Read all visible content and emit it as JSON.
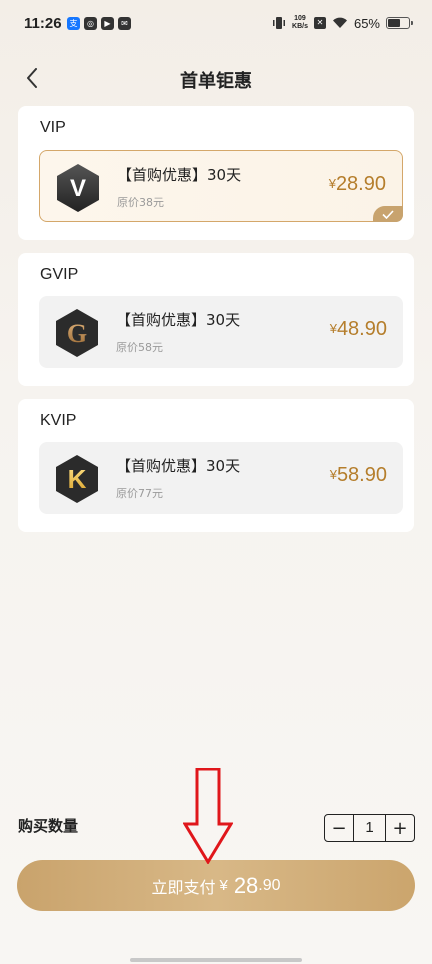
{
  "status_bar": {
    "time": "11:26",
    "app_icons": [
      "支",
      "◎",
      "▶",
      "✉"
    ],
    "net_speed_value": "109",
    "net_speed_unit": "KB/s",
    "battery_percent": "65%",
    "battery_level": 0.65
  },
  "header": {
    "title": "首单钜惠",
    "back_icon": "chevron-left-icon"
  },
  "cards": [
    {
      "title": "VIP",
      "badge_letter": "V",
      "plan_name": "【首购优惠】30天",
      "original_price": "原价38元",
      "currency": "¥",
      "price": "28.90",
      "selected": true
    },
    {
      "title": "GVIP",
      "badge_letter": "G",
      "plan_name": "【首购优惠】30天",
      "original_price": "原价58元",
      "currency": "¥",
      "price": "48.90",
      "selected": false
    },
    {
      "title": "KVIP",
      "badge_letter": "K",
      "plan_name": "【首购优惠】30天",
      "original_price": "原价77元",
      "currency": "¥",
      "price": "58.90",
      "selected": false
    }
  ],
  "quantity": {
    "label": "购买数量",
    "minus": "−",
    "value": "1",
    "plus": "+"
  },
  "pay_button": {
    "label": "立即支付",
    "currency": "¥",
    "amount_int": "28",
    "amount_dec": ".90"
  },
  "colors": {
    "accent_gold": "#b57e2c",
    "button_gold": "#d8b887",
    "annotation_red": "#e0161b"
  }
}
